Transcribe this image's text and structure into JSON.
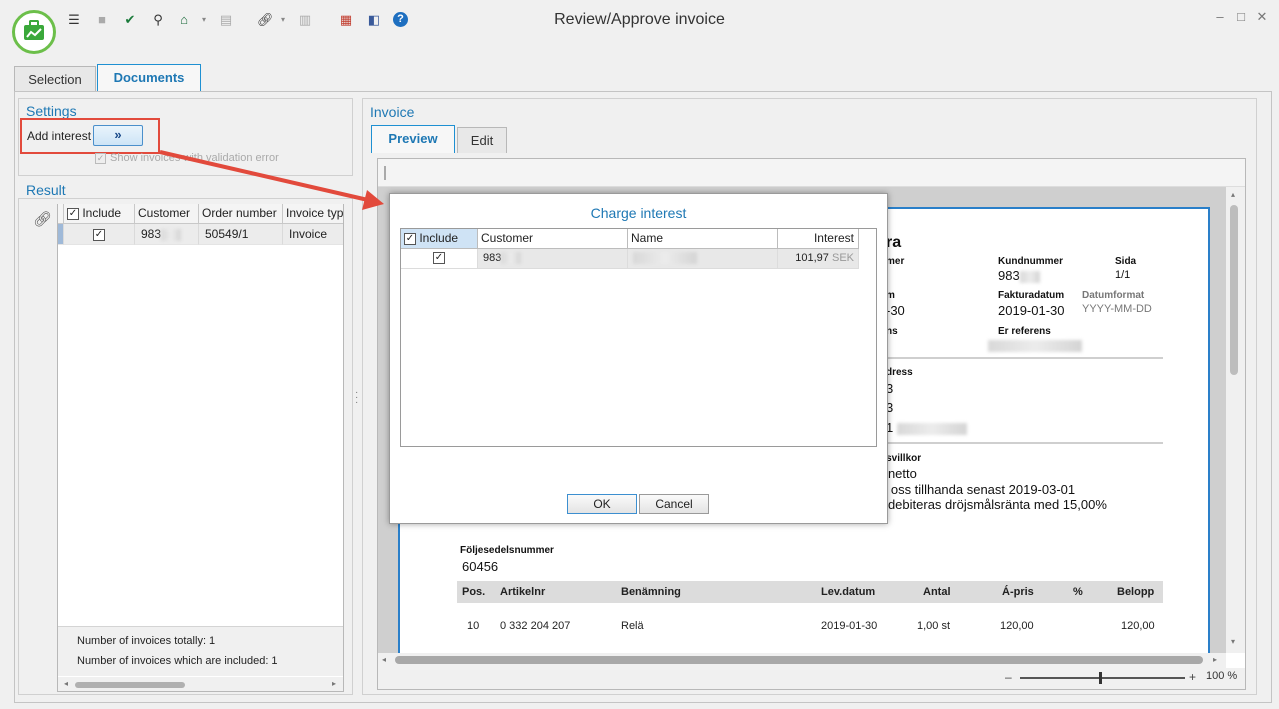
{
  "window": {
    "title": "Review/Approve invoice"
  },
  "toolbar_icons": [
    "list-icon",
    "save-icon",
    "approve-icon",
    "search-icon",
    "home-icon",
    "grid-icon",
    "link-icon",
    "table-icon",
    "color-palette-icon",
    "compare-icon",
    "help-icon"
  ],
  "tabs": [
    {
      "label": "Selection"
    },
    {
      "label": "Documents"
    }
  ],
  "settings": {
    "title": "Settings",
    "add_interest_label": "Add interest",
    "add_interest_button": "»",
    "show_invoices_label": "Show invoices with validation error"
  },
  "result": {
    "title": "Result",
    "columns": [
      "Include",
      "Customer",
      "Order number",
      "Invoice type"
    ],
    "rows": [
      {
        "customer": "983",
        "order_number": "50549/1",
        "invoice_type": "Invoice"
      }
    ],
    "total_label": "Number of invoices totally: 1",
    "included_label": "Number of invoices which are included: 1"
  },
  "invoice": {
    "title": "Invoice",
    "tabs": [
      {
        "label": "Preview"
      },
      {
        "label": "Edit"
      }
    ],
    "zoom": "100 %",
    "doc": {
      "heading_fragment": "ra",
      "fragment_mer": "mer",
      "kundnummer_label": "Kundnummer",
      "kundnummer_value": "983",
      "sida_label": "Sida",
      "sida_value": "1/1",
      "fragment_m": "m",
      "fragment_date": "-30",
      "fakturadatum_label": "Fakturadatum",
      "fakturadatum_value": "2019-01-30",
      "datumformat_label": "Datumformat",
      "datumformat_value": "YYYY-MM-DD",
      "fragment_ns": "ns",
      "er_referens_label": "Er referens",
      "fragment_dress": "dress",
      "fragment_3a": "3",
      "fragment_3b": "3",
      "fragment_1": "1",
      "fragment_villkor": "gsvillkor",
      "terms_line1": "r netto",
      "terms_line2": "g oss tillhanda senast 2019-03-01",
      "terms_line3": "r debiteras dröjsmålsränta med 15,00%",
      "foljesedel_label": "Följesedelsnummer",
      "foljesedel_value": "60456",
      "table_headers": [
        "Pos.",
        "Artikelnr",
        "Benämning",
        "Lev.datum",
        "Antal",
        "Á-pris",
        "%",
        "Belopp"
      ],
      "table_row": [
        "10",
        "0 332 204 207",
        "Relä",
        "2019-01-30",
        "1,00 st",
        "120,00",
        "",
        "120,00"
      ]
    }
  },
  "dialog": {
    "title": "Charge interest",
    "columns": [
      "Include",
      "Customer",
      "Name",
      "Interest"
    ],
    "row": {
      "customer": "983",
      "interest": "101,97",
      "currency": "SEK"
    },
    "ok_label": "OK",
    "cancel_label": "Cancel"
  },
  "colors": {
    "accent": "#1e78b4",
    "highlight": "#e24a3c",
    "logo_green": "#3aa83a"
  }
}
